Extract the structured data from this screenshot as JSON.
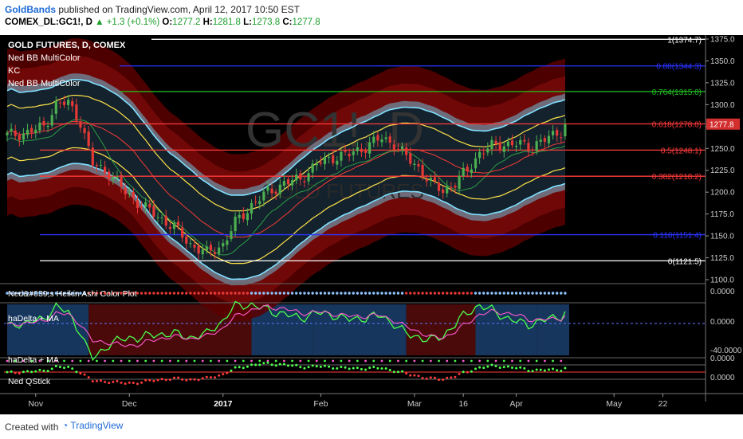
{
  "header": {
    "brand": "GoldBands",
    "published": "published on TradingView.com, April 12, 2017 10:50 EST",
    "symbol": "COMEX_DL:GC1!, D",
    "change": "+1.3 (+0.1%)",
    "o_label": "O:",
    "o_val": "1277.2",
    "h_label": "H:",
    "h_val": "1281.8",
    "l_label": "L:",
    "l_val": "1273.8",
    "c_label": "C:",
    "c_val": "1277.8"
  },
  "footer": {
    "created": "Created with",
    "brand": "TradingView"
  },
  "chart_data": {
    "type": "line",
    "title": "GOLD FUTURES, D, COMEX",
    "legend": [
      "GOLD FUTURES, D, COMEX",
      "Ned BB MultiColor",
      "KC",
      "Ned BB MultiColor"
    ],
    "watermark": "GC1!, D",
    "watermark_sub": "GOLD FUTURES",
    "ylim": [
      1100,
      1375
    ],
    "y_ticks": [
      1100.0,
      1125.0,
      1150.0,
      1175.0,
      1200.0,
      1225.0,
      1250.0,
      1275.0,
      1300.0,
      1325.0,
      1350.0,
      1375.0
    ],
    "x_ticks": [
      "Nov",
      "Dec",
      "2017",
      "Feb",
      "Mar",
      "16",
      "Apr",
      "May",
      "22"
    ],
    "x_tick_pos": [
      7,
      30,
      53,
      77,
      100,
      112,
      125,
      149,
      161
    ],
    "last_price": 1277.8,
    "fib_levels": [
      {
        "label": "1(1374.7)",
        "value": 1374.7,
        "color": "#ffffff"
      },
      {
        "label": "0.88(1344.3)",
        "value": 1344.3,
        "color": "#2a34ff"
      },
      {
        "label": "0.764(1315.0)",
        "value": 1315.0,
        "color": "#21c421"
      },
      {
        "label": "0.618(1278.0)",
        "value": 1278.0,
        "color": "#ff3b3b"
      },
      {
        "label": "0.5(1248.1)",
        "value": 1248.1,
        "color": "#ff3b3b"
      },
      {
        "label": "0.382(1218.2)",
        "value": 1218.2,
        "color": "#ff3b3b"
      },
      {
        "label": "0.118(1151.4)",
        "value": 1151.4,
        "color": "#2a34ff"
      },
      {
        "label": "0(1121.5)",
        "value": 1121.5,
        "color": "#ffffff"
      }
    ],
    "price_anchors": [
      [
        0,
        1265
      ],
      [
        5,
        1268
      ],
      [
        9,
        1275
      ],
      [
        12,
        1300
      ],
      [
        15,
        1302
      ],
      [
        18,
        1280
      ],
      [
        21,
        1232
      ],
      [
        25,
        1222
      ],
      [
        29,
        1200
      ],
      [
        33,
        1185
      ],
      [
        37,
        1172
      ],
      [
        41,
        1160
      ],
      [
        45,
        1140
      ],
      [
        49,
        1130
      ],
      [
        53,
        1140
      ],
      [
        56,
        1165
      ],
      [
        60,
        1185
      ],
      [
        64,
        1200
      ],
      [
        68,
        1210
      ],
      [
        72,
        1215
      ],
      [
        76,
        1232
      ],
      [
        80,
        1240
      ],
      [
        84,
        1243
      ],
      [
        88,
        1252
      ],
      [
        92,
        1262
      ],
      [
        95,
        1255
      ],
      [
        98,
        1240
      ],
      [
        101,
        1228
      ],
      [
        104,
        1210
      ],
      [
        107,
        1202
      ],
      [
        110,
        1210
      ],
      [
        113,
        1225
      ],
      [
        116,
        1245
      ],
      [
        119,
        1252
      ],
      [
        122,
        1255
      ],
      [
        125,
        1255
      ],
      [
        128,
        1252
      ],
      [
        131,
        1258
      ],
      [
        134,
        1264
      ],
      [
        136,
        1270
      ],
      [
        137,
        1277.8
      ]
    ],
    "panel_labels": [
      "Ned&#039;s Heikin Ashi Color Plot",
      "haDelta + MA",
      "haDelta + MA",
      "Ned QStick"
    ],
    "panel_values": [
      "0.0000",
      "0.0000",
      "-40.0000",
      "0.0000",
      "0.0000"
    ]
  }
}
